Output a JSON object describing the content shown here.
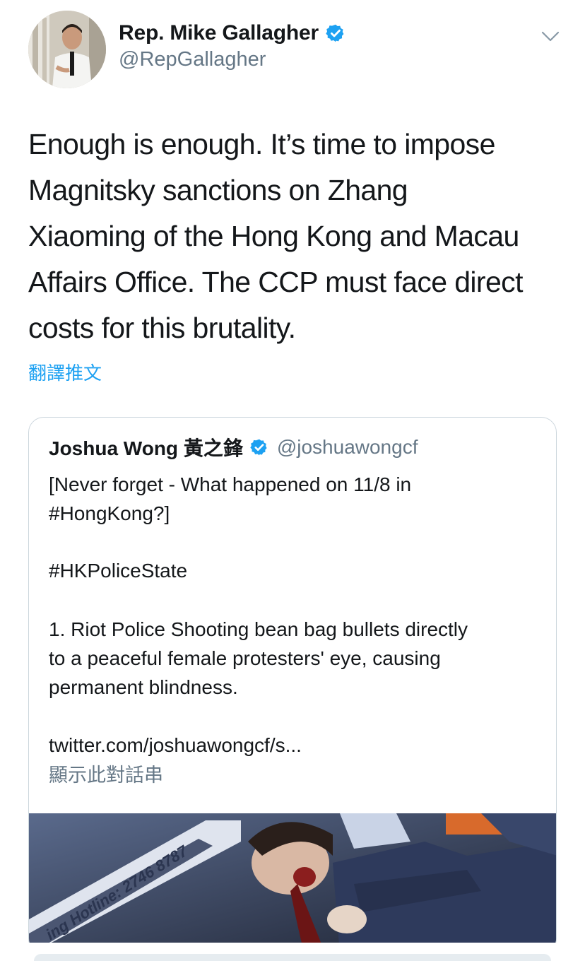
{
  "author": {
    "display_name": "Rep. Mike Gallagher",
    "handle": "@RepGallagher",
    "verified": true
  },
  "tweet": {
    "lines": [
      "Enough is enough. It’s time to impose",
      "Magnitsky sanctions on Zhang",
      "Xiaoming of the Hong Kong and Macau",
      "Affairs Office. The CCP must face direct",
      "costs for this brutality."
    ],
    "translate_label": "翻譯推文"
  },
  "quoted": {
    "display_name": "Joshua Wong 黃之鋒",
    "handle": "@joshuawongcf",
    "verified": true,
    "lines": [
      "[Never forget - What happened on 11/8 in",
      "#HongKong?]",
      "#HKPoliceState",
      "1. Riot Police Shooting bean bag bullets directly",
      "to a peaceful female protesters' eye, causing",
      "permanent blindness.",
      "twitter.com/joshuawongcf/s..."
    ],
    "show_thread_label": "顯示此對話串",
    "media_caption": "ing Hotline: 2746 8787"
  },
  "colors": {
    "text": "#14171a",
    "secondary": "#657786",
    "accent": "#1da1f2",
    "border": "#ccd6dd"
  },
  "icons": [
    "avatar",
    "verified-badge-icon",
    "chevron-down-icon"
  ]
}
